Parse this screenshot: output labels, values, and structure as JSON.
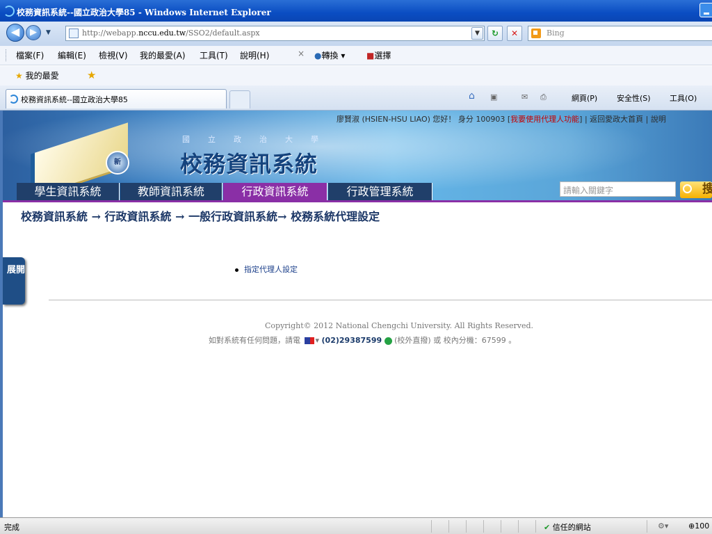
{
  "window": {
    "title": "校務資訊系統--國立政治大學85 - Windows Internet Explorer"
  },
  "address": {
    "prefix": "http://webapp.",
    "host": "nccu.edu.tw",
    "path": "/SSO2/default.aspx",
    "search_placeholder": "Bing"
  },
  "menu": {
    "items": [
      "檔案(F)",
      "編輯(E)",
      "檢視(V)",
      "我的最愛(A)",
      "工具(T)",
      "說明(H)"
    ],
    "translate": "轉換",
    "select": "選擇",
    "close_glyph": "×"
  },
  "favorites": {
    "label": "我的最愛"
  },
  "tabs": {
    "active_label": "校務資訊系統--國立政治大學85"
  },
  "commands": {
    "page": "網頁(P)",
    "safety": "安全性(S)",
    "tools": "工具(O)"
  },
  "header": {
    "user": "廖賢淑 (HSIEN-HSU LIAO) 您好！ 身分 100903 [",
    "proxy_link": "我要使用代理人功能",
    "user_end": "] | 返回愛政大首頁 | 說明",
    "university": "國立政治大學",
    "system_title": "校務資訊系統",
    "seal_text": "新"
  },
  "nav": {
    "tabs": [
      "學生資訊系統",
      "教師資訊系統",
      "行政資訊系統",
      "行政管理系統"
    ],
    "active_index": 2,
    "search_placeholder": "請輸入關鍵字",
    "search_button": "搜"
  },
  "main": {
    "breadcrumb": "校務資訊系統 → 行政資訊系統 → 一般行政資訊系統→ 校務系統代理設定",
    "expand_label": "展開",
    "links": [
      "指定代理人設定"
    ]
  },
  "footer": {
    "copyright": "Copyright© 2012 National Chengchi University. All Rights Reserved.",
    "contact_pre": "如對系統有任何問題，請電",
    "phone": "(02)29387599",
    "contact_post": "(校外直撥) 或 校內分機：67599 。"
  },
  "status": {
    "text": "完成",
    "zone": "信任的網站",
    "zoom": "100"
  },
  "colors": {
    "nav_active": "#8a2fa6",
    "nav_tab": "#203f6a",
    "title_bar": "#0a4dc2"
  },
  "icons": [
    "ie-icon",
    "back-icon",
    "forward-icon",
    "refresh-icon",
    "stop-icon",
    "bing-icon",
    "star-icon",
    "home-icon",
    "rss-icon",
    "mail-icon",
    "print-icon",
    "search-icon",
    "phone-icon",
    "flag-icon"
  ]
}
